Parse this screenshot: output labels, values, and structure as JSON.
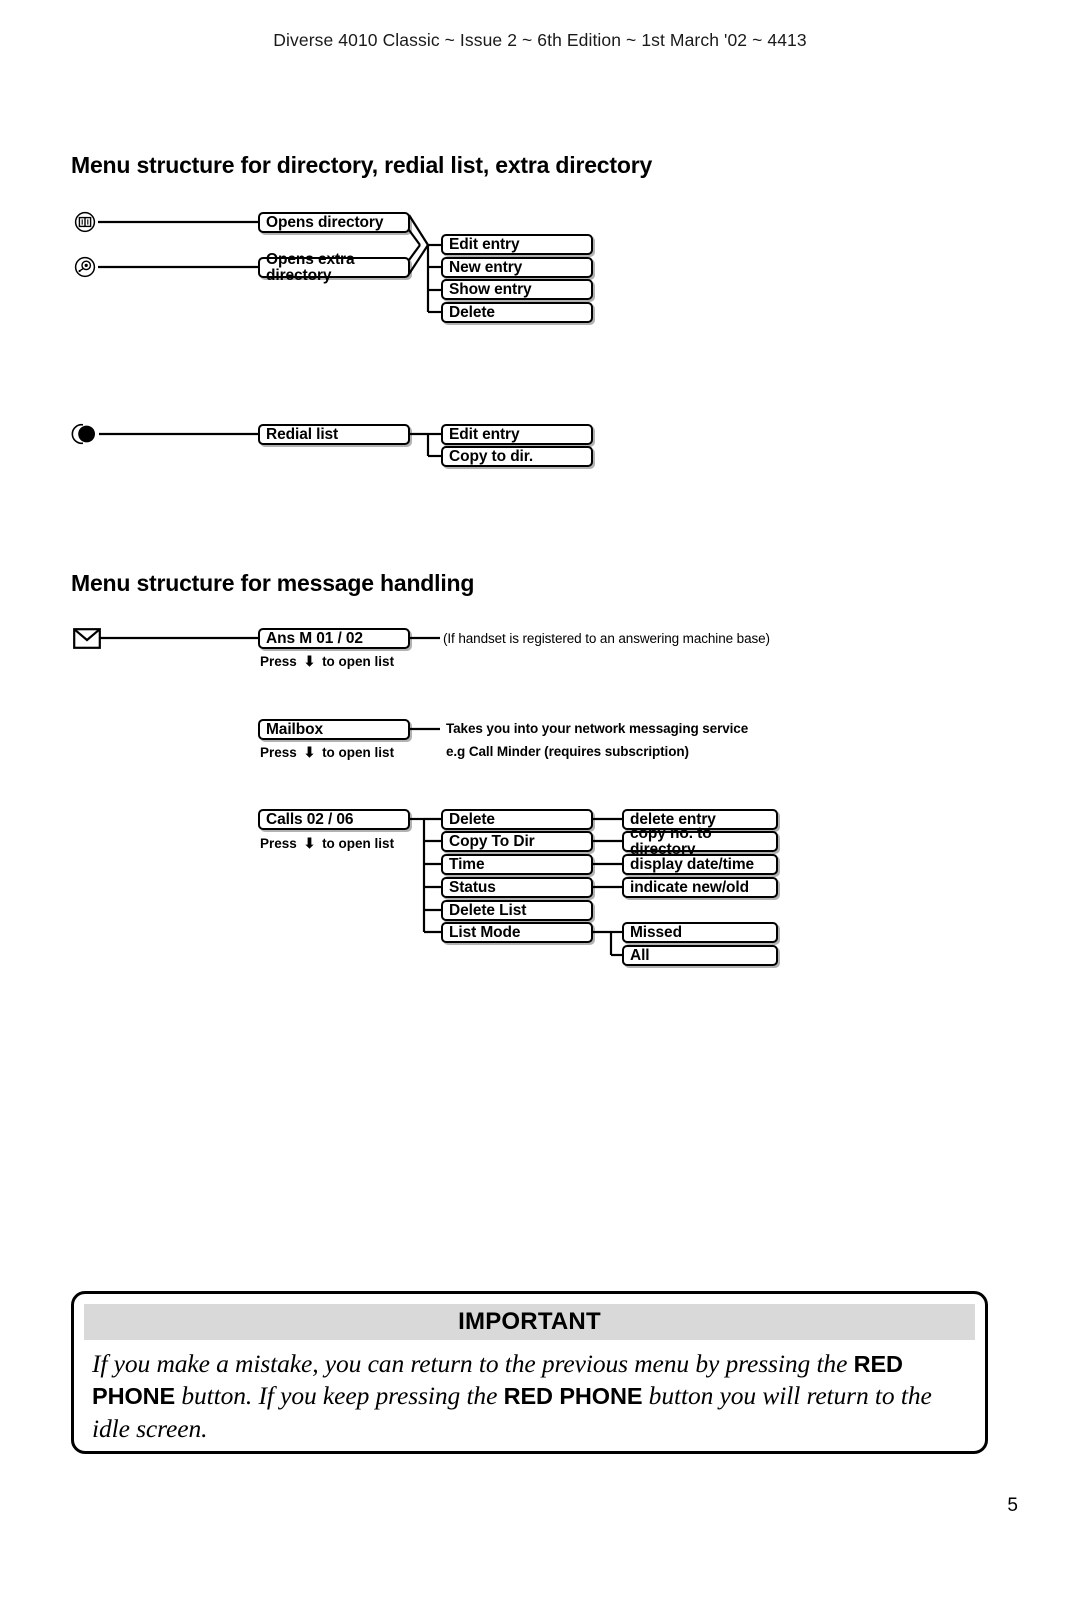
{
  "header": {
    "text": "Diverse 4010 Classic ~ Issue 2 ~ 6th Edition ~ 1st March '02 ~ 4413"
  },
  "sections": {
    "directory": {
      "heading": "Menu structure for directory, redial list, extra directory",
      "icons": [
        {
          "name": "directory-book-icon",
          "label": "directory key"
        },
        {
          "name": "extra-directory-icon",
          "label": "extra directory key"
        },
        {
          "name": "redial-icon",
          "label": "redial key"
        }
      ],
      "level1": [
        {
          "label": "Opens directory"
        },
        {
          "label": "Opens extra directory"
        }
      ],
      "level2": [
        {
          "label": "Edit entry"
        },
        {
          "label": "New entry"
        },
        {
          "label": "Show entry"
        },
        {
          "label": "Delete"
        }
      ],
      "redial": {
        "root": "Redial list",
        "children": [
          {
            "label": "Edit entry"
          },
          {
            "label": "Copy to dir."
          }
        ]
      }
    },
    "message": {
      "heading": "Menu structure for message handling",
      "press_prefix": "Press",
      "press_suffix": "to open list",
      "arrow_glyph": "⬇",
      "groups": [
        {
          "root": "Ans M 01 / 02",
          "press": true,
          "note_lines": [
            "(If handset is registered to an answering machine base)"
          ]
        },
        {
          "root": "Mailbox",
          "press": true,
          "note_lines": [
            "Takes you into your network messaging service",
            "e.g Call Minder (requires subscription)"
          ]
        },
        {
          "root": "Calls 02 / 06",
          "press": true,
          "children": [
            {
              "label": "Delete",
              "note": "delete entry"
            },
            {
              "label": "Copy To Dir",
              "note": "copy no. to directory"
            },
            {
              "label": "Time",
              "note": "display date/time"
            },
            {
              "label": "Status",
              "note": "indicate new/old"
            },
            {
              "label": "Delete List",
              "note": null
            },
            {
              "label": "List Mode",
              "note": null,
              "sub": [
                "Missed",
                "All"
              ]
            }
          ]
        }
      ]
    }
  },
  "important": {
    "title": "IMPORTANT",
    "body_part1": "If you make a mistake, you can return to the previous menu by pressing the ",
    "body_bold1": "RED PHONE",
    "body_part2": " button. If you keep pressing the ",
    "body_bold2": "RED PHONE",
    "body_part3": " button you will return to the idle screen."
  },
  "page_number": "5"
}
